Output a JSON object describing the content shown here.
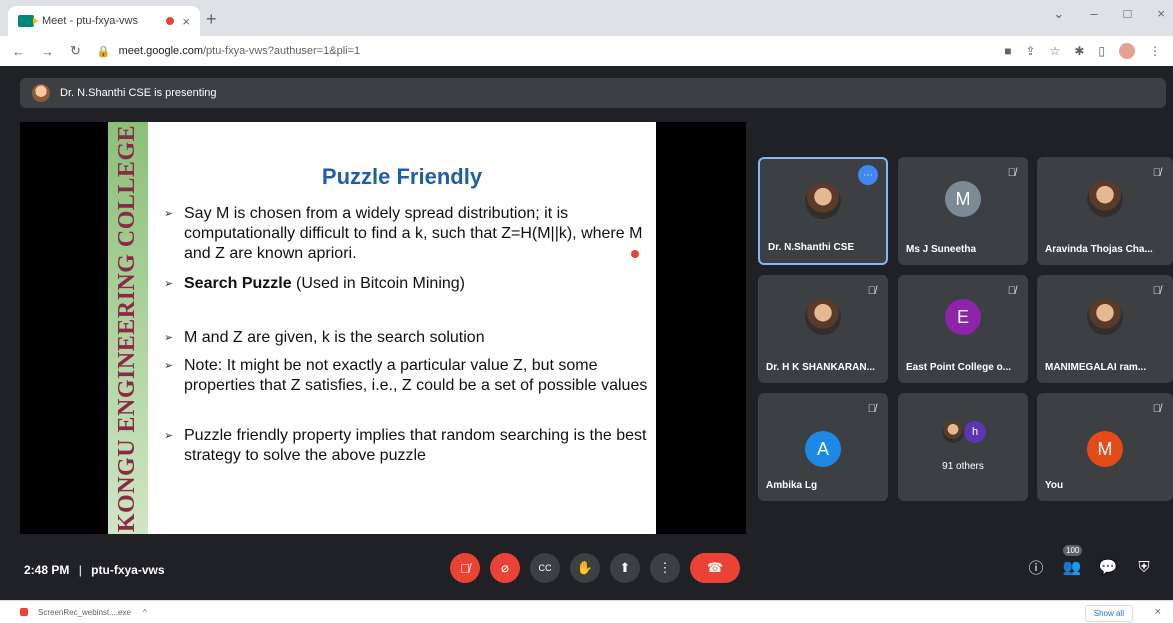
{
  "browser": {
    "tab_title": "Meet - ptu-fxya-vws",
    "url_host": "meet.google.com",
    "url_path": "/ptu-fxya-vws?authuser=1&pli=1",
    "new_tab": "+",
    "close_tab": "×",
    "win": [
      "⌄",
      "–",
      "□",
      "×"
    ]
  },
  "meet": {
    "presenting_text": "Dr. N.Shanthi CSE is presenting",
    "slide": {
      "college": "KONGU ENGINEERING COLLEGE",
      "title": "Puzzle Friendly",
      "b1": "Say M is chosen from a widely spread distribution; it is computationally difficult to find a k, such that Z=H(M||k), where M and Z are known apriori.",
      "b2_strong": "Search Puzzle",
      "b2_rest": " (Used in Bitcoin Mining)",
      "b3": "M and Z are given, k is the search solution",
      "b4": "Note: It might be not exactly a particular value Z, but some properties that Z satisfies, i.e., Z could be a set of possible values",
      "b5": "Puzzle friendly property implies that random searching is the best strategy to solve the above puzzle"
    },
    "participants": [
      {
        "name": "Dr. N.Shanthi CSE",
        "initial": "",
        "color": ""
      },
      {
        "name": "Ms J Suneetha",
        "initial": "M",
        "color": "#7c8a96"
      },
      {
        "name": "Aravinda Thojas Cha...",
        "initial": "",
        "color": ""
      },
      {
        "name": "Dr. H K SHANKARAN...",
        "initial": "",
        "color": ""
      },
      {
        "name": "East Point College o...",
        "initial": "E",
        "color": "#8e24aa"
      },
      {
        "name": "MANIMEGALAI ram...",
        "initial": "",
        "color": ""
      },
      {
        "name": "Ambika Lg",
        "initial": "A",
        "color": "#1e88e5"
      },
      {
        "name": "91 others",
        "initial": "h",
        "color": "#5e35b1"
      },
      {
        "name": "You",
        "initial": "M",
        "color": "#e64a19"
      }
    ],
    "clock": "2:48 PM",
    "separator": "|",
    "meeting_code": "ptu-fxya-vws",
    "people_count": "100"
  },
  "icons": {
    "mic_off": "🎙",
    "cam_off": "⌀",
    "cc": "CC",
    "hand": "✋",
    "present": "⬆",
    "more": "⋮",
    "end": "☎",
    "info": "ⓘ",
    "people": "👥",
    "chat": "💬",
    "activities": "⚙"
  },
  "shelf": {
    "filename": "ScreenRec_webinst....exe",
    "show_all": "Show all"
  }
}
